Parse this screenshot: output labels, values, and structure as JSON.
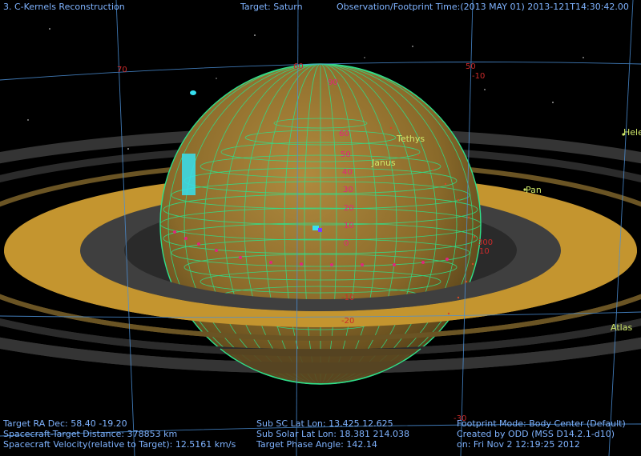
{
  "header": {
    "title": "3. C-Kernels Reconstruction",
    "target": "Target: Saturn",
    "obs_time": "Observation/Footprint Time:(2013 MAY 01) 2013-121T14:30:42.00"
  },
  "sky_grid_labels": [
    "70",
    "60",
    "50",
    "-10",
    "300",
    "10",
    "-10",
    "-20",
    "-30"
  ],
  "planet_lat_labels": [
    "90",
    "60",
    "50",
    "40",
    "30",
    "20",
    "10",
    "0"
  ],
  "moons": [
    {
      "name": "Tethys"
    },
    {
      "name": "Janus"
    },
    {
      "name": "Pan"
    },
    {
      "name": "Atlas"
    },
    {
      "name": "Hele"
    }
  ],
  "footer": {
    "left": [
      "Target RA Dec: 58.40  -19.20",
      "Spacecraft-Target Distance:  378853 km",
      "Spacecraft Velocity(relative to Target): 12.5161 km/s"
    ],
    "middle": [
      "Sub SC Lat Lon: 13.425  12.625",
      "Sub Solar Lat Lon: 18.381  214.038",
      "Target Phase Angle: 142.14"
    ],
    "right": [
      "Footprint Mode: Body Center (Default)",
      "Created by ODD (MSS D14.2.1-d10)",
      "on: Fri Nov  2 12:19:25 2012"
    ]
  },
  "colors": {
    "hud_text": "#7fb3ff",
    "moon_label": "#cfe86a",
    "planet_grid": "#2fe08a",
    "ring_main": "#c4952f",
    "sky_grid": "#4b8fd6"
  }
}
